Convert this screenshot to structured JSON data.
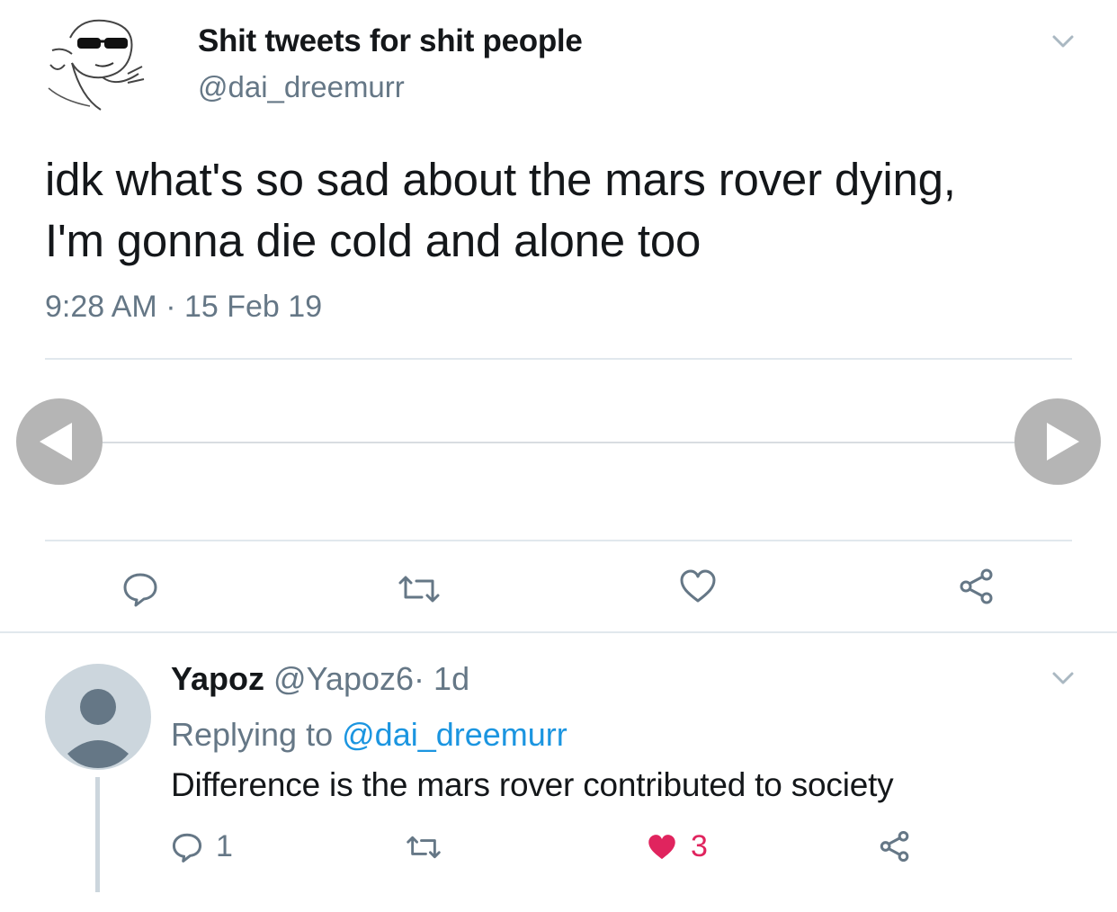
{
  "tweet": {
    "display_name": "Shit tweets for shit people",
    "handle": "@dai_dreemurr",
    "text_line1": "idk what's so sad about the mars rover dying,",
    "text_line2": "I'm gonna die cold and alone too",
    "time": "9:28 AM",
    "separator": "·",
    "date": "15 Feb 19"
  },
  "actions": [
    "reply-icon",
    "retweet-icon",
    "like-icon",
    "share-icon"
  ],
  "reply": {
    "display_name": "Yapoz",
    "handle": "@Yapoz6",
    "separator": "·",
    "age": "1d",
    "replying_prefix": "Replying to",
    "replying_handle": "@dai_dreemurr",
    "text": "Difference is the mars rover contributed to society",
    "reply_count": "1",
    "like_count": "3"
  },
  "colors": {
    "text": "#14171a",
    "secondary": "#657786",
    "link": "#1b95e0",
    "like": "#e0245e",
    "divider": "#e1e8ed",
    "carousel_button": "#b5b5b5"
  }
}
